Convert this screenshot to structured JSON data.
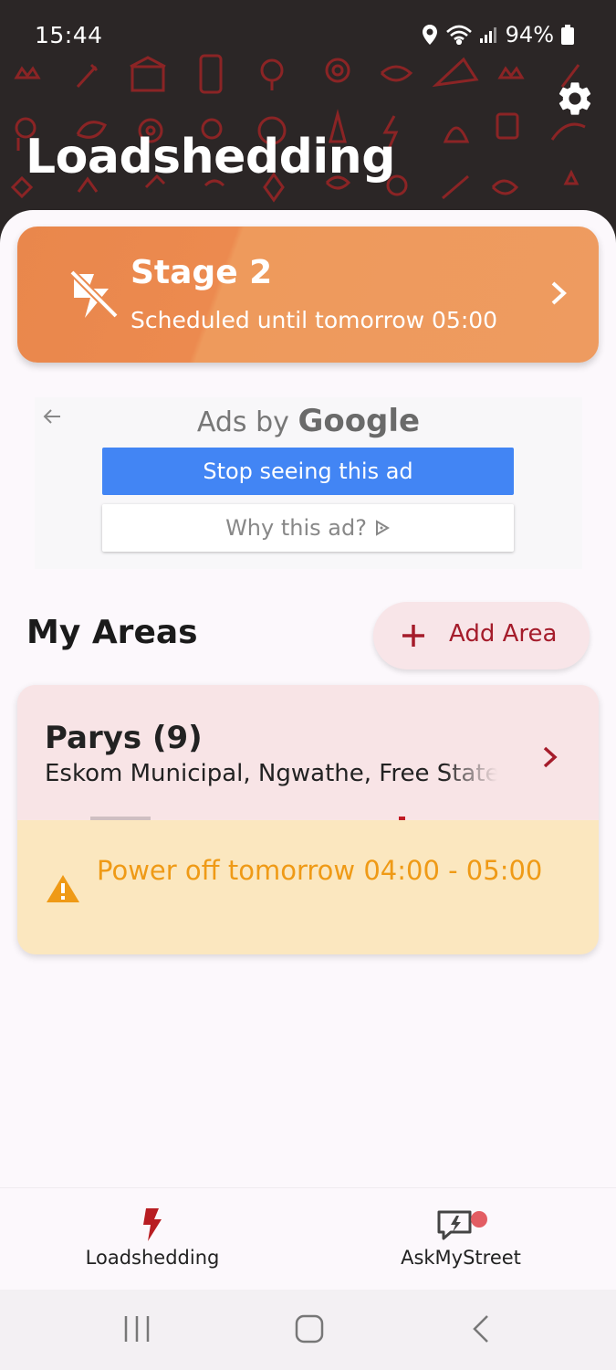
{
  "status_bar": {
    "time": "15:44",
    "battery": "94%"
  },
  "header": {
    "title": "Loadshedding"
  },
  "stage_card": {
    "title": "Stage 2",
    "subtitle": "Scheduled until tomorrow 05:00",
    "accent": "#ea8a4f"
  },
  "ad": {
    "ads_by": "Ads by",
    "brand": "Google",
    "stop_label": "Stop seeing this ad",
    "why_label": "Why this ad?"
  },
  "areas": {
    "title": "My Areas",
    "add_label": "Add Area",
    "items": [
      {
        "name": "Parys (9)",
        "location": "Eskom Municipal, Ngwathe, Free State",
        "warning": "Power off tomorrow 04:00 - 05:00"
      }
    ]
  },
  "bottom_nav": {
    "items": [
      {
        "label": "Loadshedding",
        "icon": "lightning-bolt-icon",
        "active": true
      },
      {
        "label": "AskMyStreet",
        "icon": "chat-bolt-icon",
        "badge": true
      }
    ]
  },
  "colors": {
    "header_bg": "#2b2626",
    "pattern": "#8b2425",
    "brand_red": "#a51c2b",
    "warning": "#ef9a16"
  }
}
